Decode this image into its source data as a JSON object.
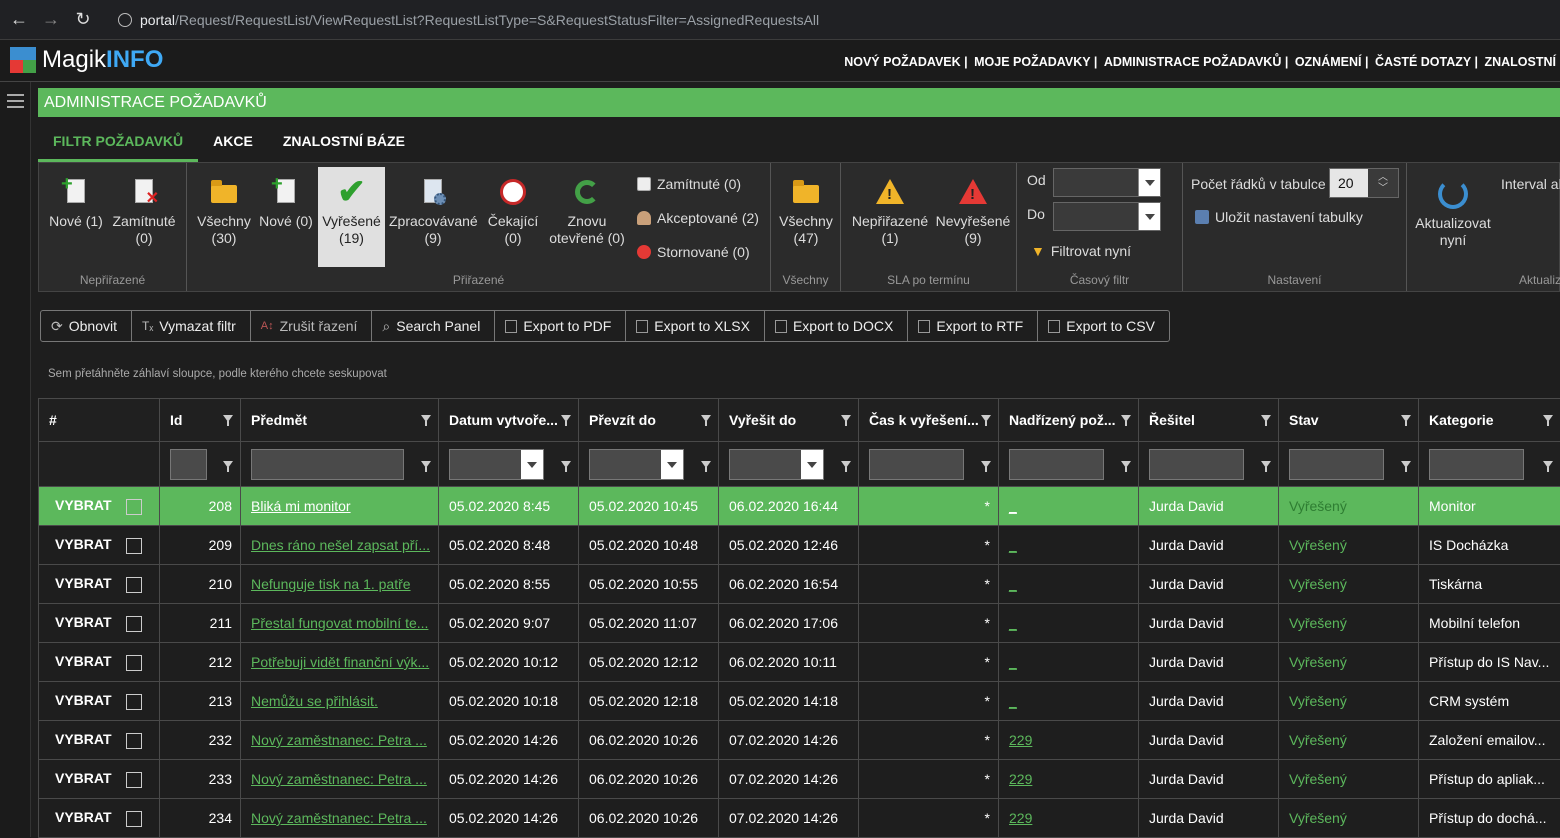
{
  "browser": {
    "url_host": "portal",
    "url_path": "/Request/RequestList/ViewRequestList?RequestListType=S&RequestStatusFilter=AssignedRequestsAll"
  },
  "logo": {
    "part1": "Magik",
    "part2": "INFO"
  },
  "topmenu": [
    "NOVÝ POŽADAVEK",
    "MOJE POŽADAVKY",
    "ADMINISTRACE POŽADAVKŮ",
    "OZNÁMENÍ",
    "ČASTÉ DOTAZY",
    "ZNALOSTNÍ"
  ],
  "page_title": "ADMINISTRACE POŽADAVKŮ",
  "tabs": [
    "FILTR POŽADAVKŮ",
    "AKCE",
    "ZNALOSTNÍ BÁZE"
  ],
  "ribbon": {
    "nepriraz": {
      "title": "Nepřiřazené",
      "nove": [
        "Nové (1)"
      ],
      "zamitnute": [
        "Zamítnuté",
        "(0)"
      ]
    },
    "priraz": {
      "title": "Přiřazené",
      "vsechny": [
        "Všechny",
        "(30)"
      ],
      "nove": [
        "Nové (0)"
      ],
      "vyresene": [
        "Vyřešené",
        "(19)"
      ],
      "zpracovavane": [
        "Zpracovávané",
        "(9)"
      ],
      "cekajici": [
        "Čekající",
        "(0)"
      ],
      "znovu": [
        "Znovu",
        "otevřené (0)"
      ],
      "zamitnute": "Zamítnuté (0)",
      "akceptovane": "Akceptované (2)",
      "stornovane": "Stornované (0)"
    },
    "vsechny": {
      "title": "Všechny",
      "btn": [
        "Všechny",
        "(47)"
      ]
    },
    "sla": {
      "title": "SLA po termínu",
      "neprirazene": [
        "Nepřiřazené",
        "(1)"
      ],
      "nevyresene": [
        "Nevyřešené",
        "(9)"
      ]
    },
    "casovy": {
      "title": "Časový filtr",
      "od": "Od",
      "do": "Do",
      "filtrovat": "Filtrovat nyní"
    },
    "nastaveni": {
      "title": "Nastavení",
      "pocet": "Počet řádků v tabulce",
      "pocet_value": "20",
      "ulozit": "Uložit nastavení tabulky"
    },
    "aktualizace": {
      "title": "Aktualiz",
      "btn": [
        "Aktualizovat",
        "nyní"
      ],
      "interval": "Interval ak"
    }
  },
  "toolbar": [
    "Obnovit",
    "Vymazat filtr",
    "Zrušit řazení",
    "Search Panel",
    "Export to PDF",
    "Export to XLSX",
    "Export to DOCX",
    "Export to RTF",
    "Export to CSV"
  ],
  "group_hint": "Sem přetáhněte záhlaví sloupce, podle kterého chcete seskupovat",
  "columns": [
    "#",
    "Id",
    "Předmět",
    "Datum vytvoře...",
    "Převzít do",
    "Vyřešit do",
    "Čas k vyřešení...",
    "Nadřízený pož...",
    "Řešitel",
    "Stav",
    "Kategorie"
  ],
  "select_label": "VYBRAT",
  "rows": [
    {
      "id": "208",
      "predmet": "Bliká mi monitor",
      "datum": "05.02.2020 8:45",
      "prevzit": "05.02.2020 10:45",
      "vyresit": "06.02.2020 16:44",
      "cas": "*",
      "nadrizeny": "_",
      "resitel": "Jurda David",
      "stav": "Vyřešený",
      "kategorie": "Monitor"
    },
    {
      "id": "209",
      "predmet": "Dnes ráno nešel zapsat pří...",
      "datum": "05.02.2020 8:48",
      "prevzit": "05.02.2020 10:48",
      "vyresit": "05.02.2020 12:46",
      "cas": "*",
      "nadrizeny": "_",
      "resitel": "Jurda David",
      "stav": "Vyřešený",
      "kategorie": "IS Docházka"
    },
    {
      "id": "210",
      "predmet": "Nefunguje tisk na 1. patře",
      "datum": "05.02.2020 8:55",
      "prevzit": "05.02.2020 10:55",
      "vyresit": "06.02.2020 16:54",
      "cas": "*",
      "nadrizeny": "_",
      "resitel": "Jurda David",
      "stav": "Vyřešený",
      "kategorie": "Tiskárna"
    },
    {
      "id": "211",
      "predmet": "Přestal fungovat mobilní te...",
      "datum": "05.02.2020 9:07",
      "prevzit": "05.02.2020 11:07",
      "vyresit": "06.02.2020 17:06",
      "cas": "*",
      "nadrizeny": "_",
      "resitel": "Jurda David",
      "stav": "Vyřešený",
      "kategorie": "Mobilní telefon"
    },
    {
      "id": "212",
      "predmet": "Potřebuji vidět finanční výk...",
      "datum": "05.02.2020 10:12",
      "prevzit": "05.02.2020 12:12",
      "vyresit": "06.02.2020 10:11",
      "cas": "*",
      "nadrizeny": "_",
      "resitel": "Jurda David",
      "stav": "Vyřešený",
      "kategorie": "Přístup do IS Nav..."
    },
    {
      "id": "213",
      "predmet": "Nemůžu se přihlásit.",
      "datum": "05.02.2020 10:18",
      "prevzit": "05.02.2020 12:18",
      "vyresit": "05.02.2020 14:18",
      "cas": "*",
      "nadrizeny": "_",
      "resitel": "Jurda David",
      "stav": "Vyřešený",
      "kategorie": "CRM systém"
    },
    {
      "id": "232",
      "predmet": "Nový zaměstnanec: Petra ...",
      "datum": "05.02.2020 14:26",
      "prevzit": "06.02.2020 10:26",
      "vyresit": "07.02.2020 14:26",
      "cas": "*",
      "nadrizeny": "229",
      "resitel": "Jurda David",
      "stav": "Vyřešený",
      "kategorie": "Založení emailov..."
    },
    {
      "id": "233",
      "predmet": "Nový zaměstnanec: Petra ...",
      "datum": "05.02.2020 14:26",
      "prevzit": "06.02.2020 10:26",
      "vyresit": "07.02.2020 14:26",
      "cas": "*",
      "nadrizeny": "229",
      "resitel": "Jurda David",
      "stav": "Vyřešený",
      "kategorie": "Přístup do apliak..."
    },
    {
      "id": "234",
      "predmet": "Nový zaměstnanec: Petra ...",
      "datum": "05.02.2020 14:26",
      "prevzit": "06.02.2020 10:26",
      "vyresit": "07.02.2020 14:26",
      "cas": "*",
      "nadrizeny": "229",
      "resitel": "Jurda David",
      "stav": "Vyřešený",
      "kategorie": "Přístup do dochá..."
    }
  ]
}
